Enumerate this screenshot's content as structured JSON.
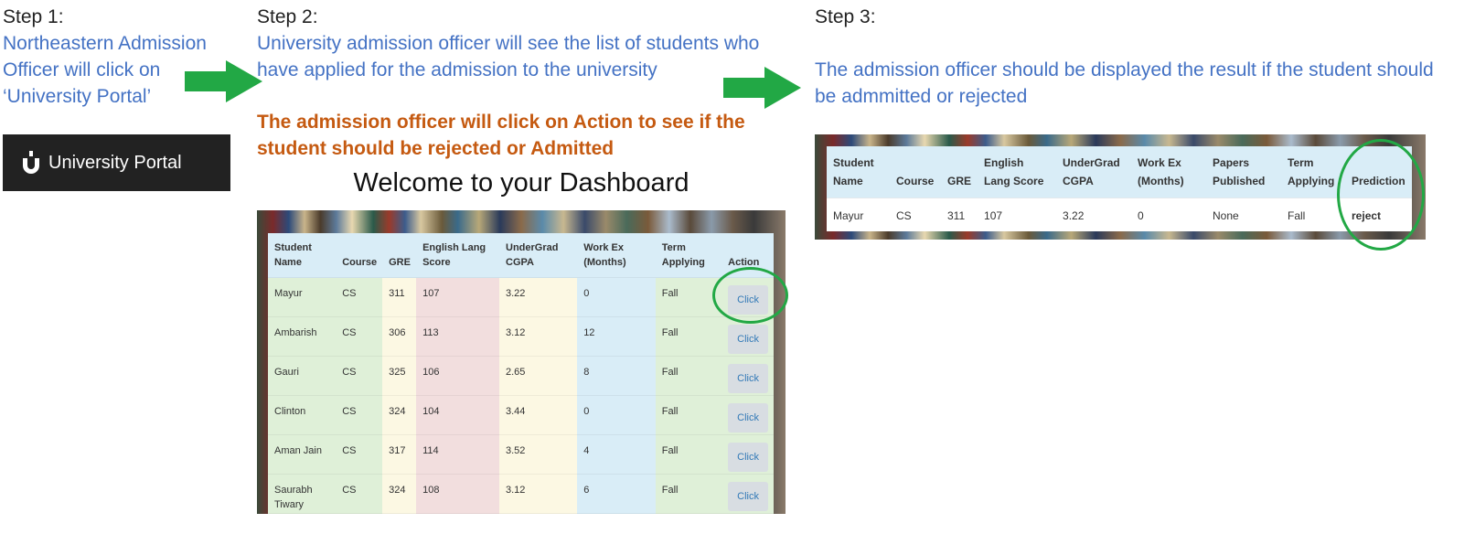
{
  "step1": {
    "heading": "Step 1:",
    "description": "Northeastern Admission Officer will click on ‘University Portal’",
    "portal_button_label": "University Portal"
  },
  "step2": {
    "heading": "Step 2:",
    "description": "University admission officer will see the list of students who have applied for the admission to the university",
    "note": "The admission officer will click on Action to see if the student should be rejected or Admitted",
    "dashboard_title": "Welcome to your Dashboard",
    "columns": [
      "Student Name",
      "Course",
      "GRE",
      "English Lang Score",
      "UnderGrad CGPA",
      "Work Ex (Months)",
      "Term Applying",
      "Action"
    ],
    "rows": [
      {
        "name": "Mayur",
        "course": "CS",
        "gre": "311",
        "english": "107",
        "cgpa": "3.22",
        "workex": "0",
        "term": "Fall",
        "action": "Click"
      },
      {
        "name": "Ambarish",
        "course": "CS",
        "gre": "306",
        "english": "113",
        "cgpa": "3.12",
        "workex": "12",
        "term": "Fall",
        "action": "Click"
      },
      {
        "name": "Gauri",
        "course": "CS",
        "gre": "325",
        "english": "106",
        "cgpa": "2.65",
        "workex": "8",
        "term": "Fall",
        "action": "Click"
      },
      {
        "name": "Clinton",
        "course": "CS",
        "gre": "324",
        "english": "104",
        "cgpa": "3.44",
        "workex": "0",
        "term": "Fall",
        "action": "Click"
      },
      {
        "name": "Aman Jain",
        "course": "CS",
        "gre": "317",
        "english": "114",
        "cgpa": "3.52",
        "workex": "4",
        "term": "Fall",
        "action": "Click"
      },
      {
        "name": "Saurabh Tiwary",
        "course": "CS",
        "gre": "324",
        "english": "108",
        "cgpa": "3.12",
        "workex": "6",
        "term": "Fall",
        "action": "Click"
      }
    ]
  },
  "step3": {
    "heading": "Step 3:",
    "description": "The admission officer should be displayed the result if the student should be admmitted or rejected",
    "columns": [
      "Student Name",
      "Course",
      "GRE",
      "English Lang Score",
      "UnderGrad CGPA",
      "Work Ex (Months)",
      "Papers Published",
      "Term Applying",
      "Prediction"
    ],
    "row": {
      "name": "Mayur",
      "course": "CS",
      "gre": "311",
      "english": "107",
      "cgpa": "3.22",
      "workex": "0",
      "papers": "None",
      "term": "Fall",
      "prediction": "reject"
    }
  },
  "colors": {
    "blue_text": "#4472C4",
    "orange_text": "#C55A11",
    "arrow_green": "#22A845",
    "portal_bg": "#222222"
  },
  "icons": [
    "university-logo-icon",
    "arrow-right-icon",
    "highlight-circle"
  ]
}
